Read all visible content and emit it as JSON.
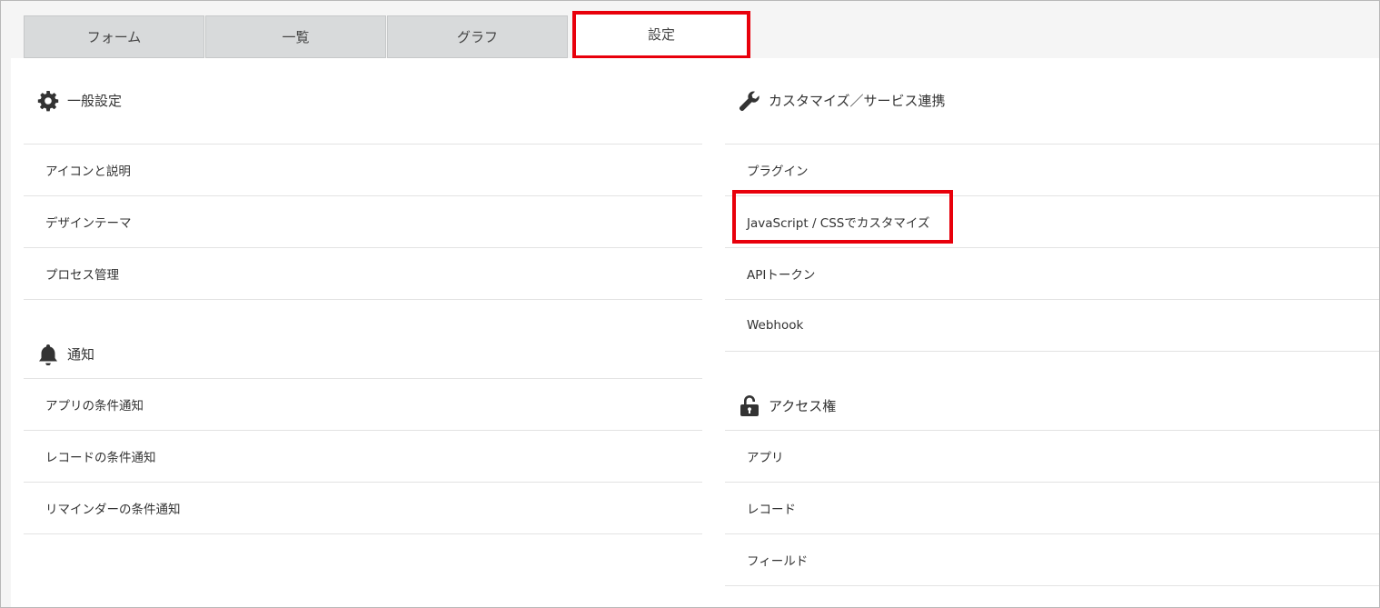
{
  "tabs": [
    {
      "label": "フォーム"
    },
    {
      "label": "一覧"
    },
    {
      "label": "グラフ"
    },
    {
      "label": "設定"
    }
  ],
  "left": {
    "sections": [
      {
        "title": "一般設定",
        "icon": "gear-icon",
        "items": [
          "アイコンと説明",
          "デザインテーマ",
          "プロセス管理"
        ]
      },
      {
        "title": "通知",
        "icon": "bell-icon",
        "items": [
          "アプリの条件通知",
          "レコードの条件通知",
          "リマインダーの条件通知"
        ]
      }
    ]
  },
  "right": {
    "sections": [
      {
        "title": "カスタマイズ／サービス連携",
        "icon": "wrench-icon",
        "items": [
          "プラグイン",
          "JavaScript / CSSでカスタマイズ",
          "APIトークン",
          "Webhook"
        ]
      },
      {
        "title": "アクセス権",
        "icon": "unlock-icon",
        "items": [
          "アプリ",
          "レコード",
          "フィールド"
        ]
      }
    ]
  },
  "highlight_color": "#e8000b"
}
